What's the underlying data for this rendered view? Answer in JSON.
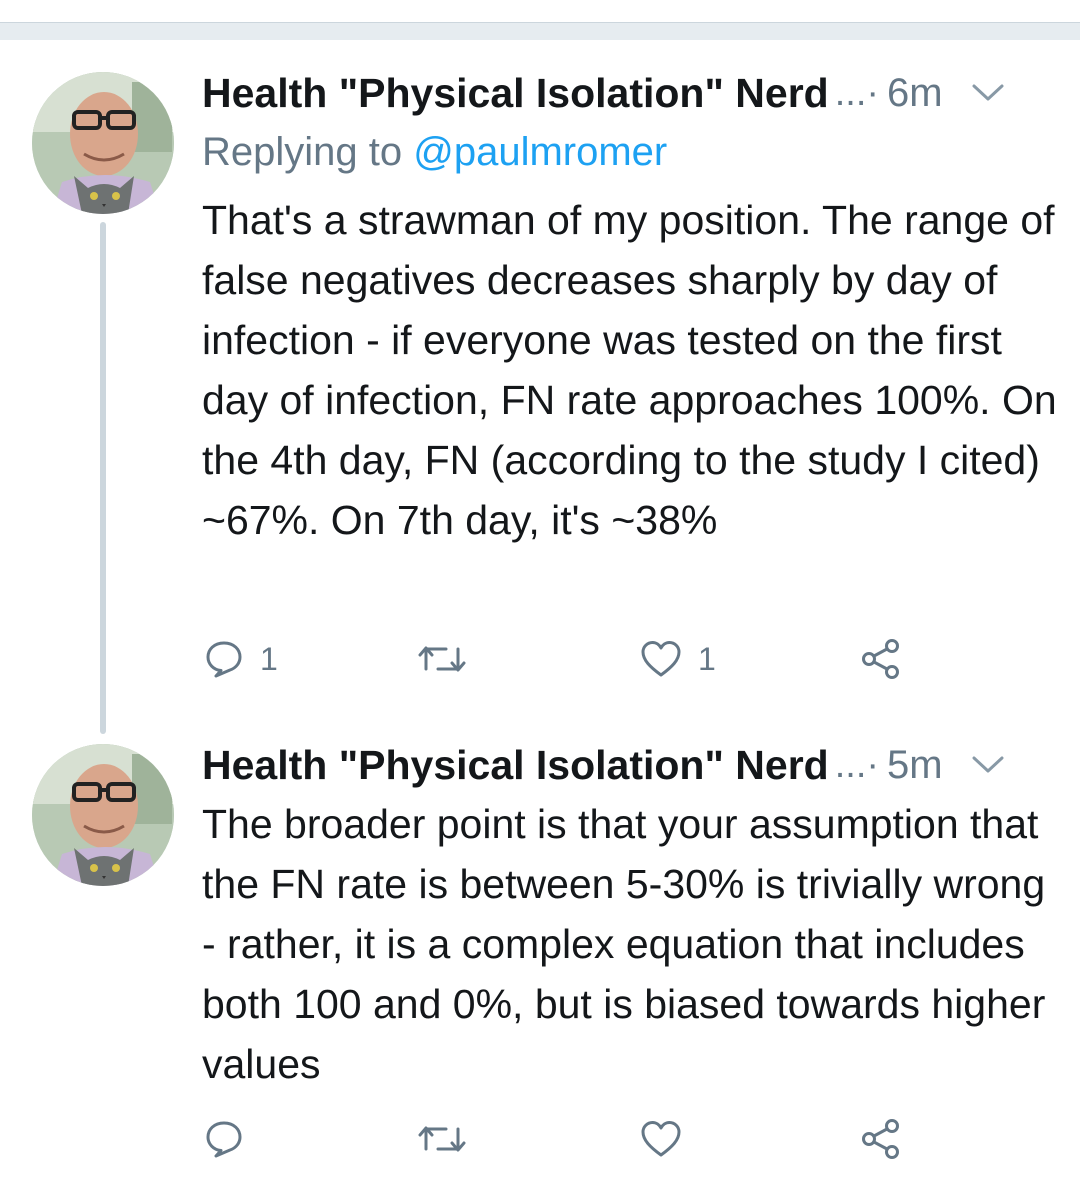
{
  "tweets": [
    {
      "name": "Health \"Physical Isolation\" Nerd",
      "ellipsis": "...·",
      "time": "6m",
      "reply_prefix": "Replying to ",
      "reply_handle": "@paulmromer",
      "text": "That's a strawman of my position. The range of false negatives decreases sharply by day of infection - if everyone was tested on the first day of infection, FN rate approaches 100%. On the 4th day, FN (according to the study I cited) ~67%. On 7th day, it's ~38%",
      "reply_count": "1",
      "like_count": "1"
    },
    {
      "name": "Health \"Physical Isolation\" Nerd",
      "ellipsis": "...·",
      "time": "5m",
      "text": "The broader point is that your assumption that the FN rate is between 5-30% is trivially wrong - rather, it is a complex equation that includes both 100 and 0%, but is biased towards higher values"
    }
  ],
  "colors": {
    "text": "#14171a",
    "secondary": "#657786",
    "link": "#1da1f2",
    "divider": "#e6ecf0"
  },
  "icons": {
    "reply": "reply-icon",
    "retweet": "retweet-icon",
    "like": "like-icon",
    "share": "share-icon",
    "menu": "chevron-down-icon"
  }
}
